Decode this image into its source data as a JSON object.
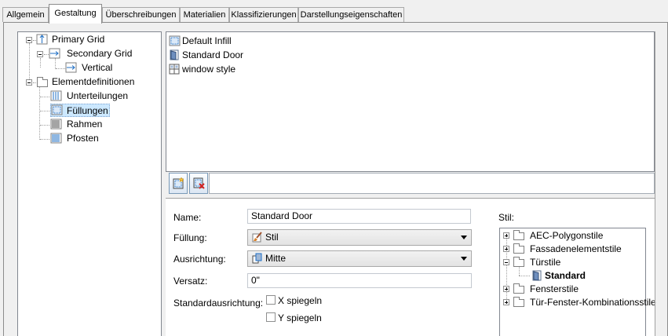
{
  "tabs": [
    {
      "label": "Allgemein"
    },
    {
      "label": "Gestaltung"
    },
    {
      "label": "Überschreibungen"
    },
    {
      "label": "Materialien"
    },
    {
      "label": "Klassifizierungen"
    },
    {
      "label": "Darstellungseigenschaften"
    }
  ],
  "active_tab": "Gestaltung",
  "left_tree": {
    "primary_grid": "Primary Grid",
    "secondary_grid": "Secondary Grid",
    "vertical": "Vertical",
    "element_definitions": "Elementdefinitionen",
    "unterteilungen": "Unterteilungen",
    "fuellungen": "Füllungen",
    "rahmen": "Rahmen",
    "pfosten": "Pfosten"
  },
  "selected_tree_item": "Füllungen",
  "style_list": [
    {
      "label": "Default Infill",
      "icon": "infill-icon"
    },
    {
      "label": "Standard Door",
      "icon": "door-icon"
    },
    {
      "label": "window style",
      "icon": "window-icon"
    }
  ],
  "buttons": {
    "new_icon": "new-infill-icon",
    "delete_icon": "delete-infill-icon"
  },
  "props": {
    "name_label": "Name:",
    "name_value": "Standard Door",
    "fill_label": "Füllung:",
    "fill_value": "Stil",
    "orient_label": "Ausrichtung:",
    "orient_value": "Mitte",
    "offset_label": "Versatz:",
    "offset_value": "0\"",
    "std_orient_label": "Standardausrichtung:",
    "mirror_x": "X spiegeln",
    "mirror_y": "Y spiegeln"
  },
  "stil": {
    "label": "Stil:",
    "items": [
      "AEC-Polygonstile",
      "Fassadenelementstile",
      "Türstile",
      "Standard",
      "Fensterstile",
      "Tür-Fenster-Kombinationsstile"
    ]
  },
  "colors": {
    "selection": "#cce8ff",
    "icon_blue": "#1f6fc5",
    "delete_red": "#d42020"
  }
}
